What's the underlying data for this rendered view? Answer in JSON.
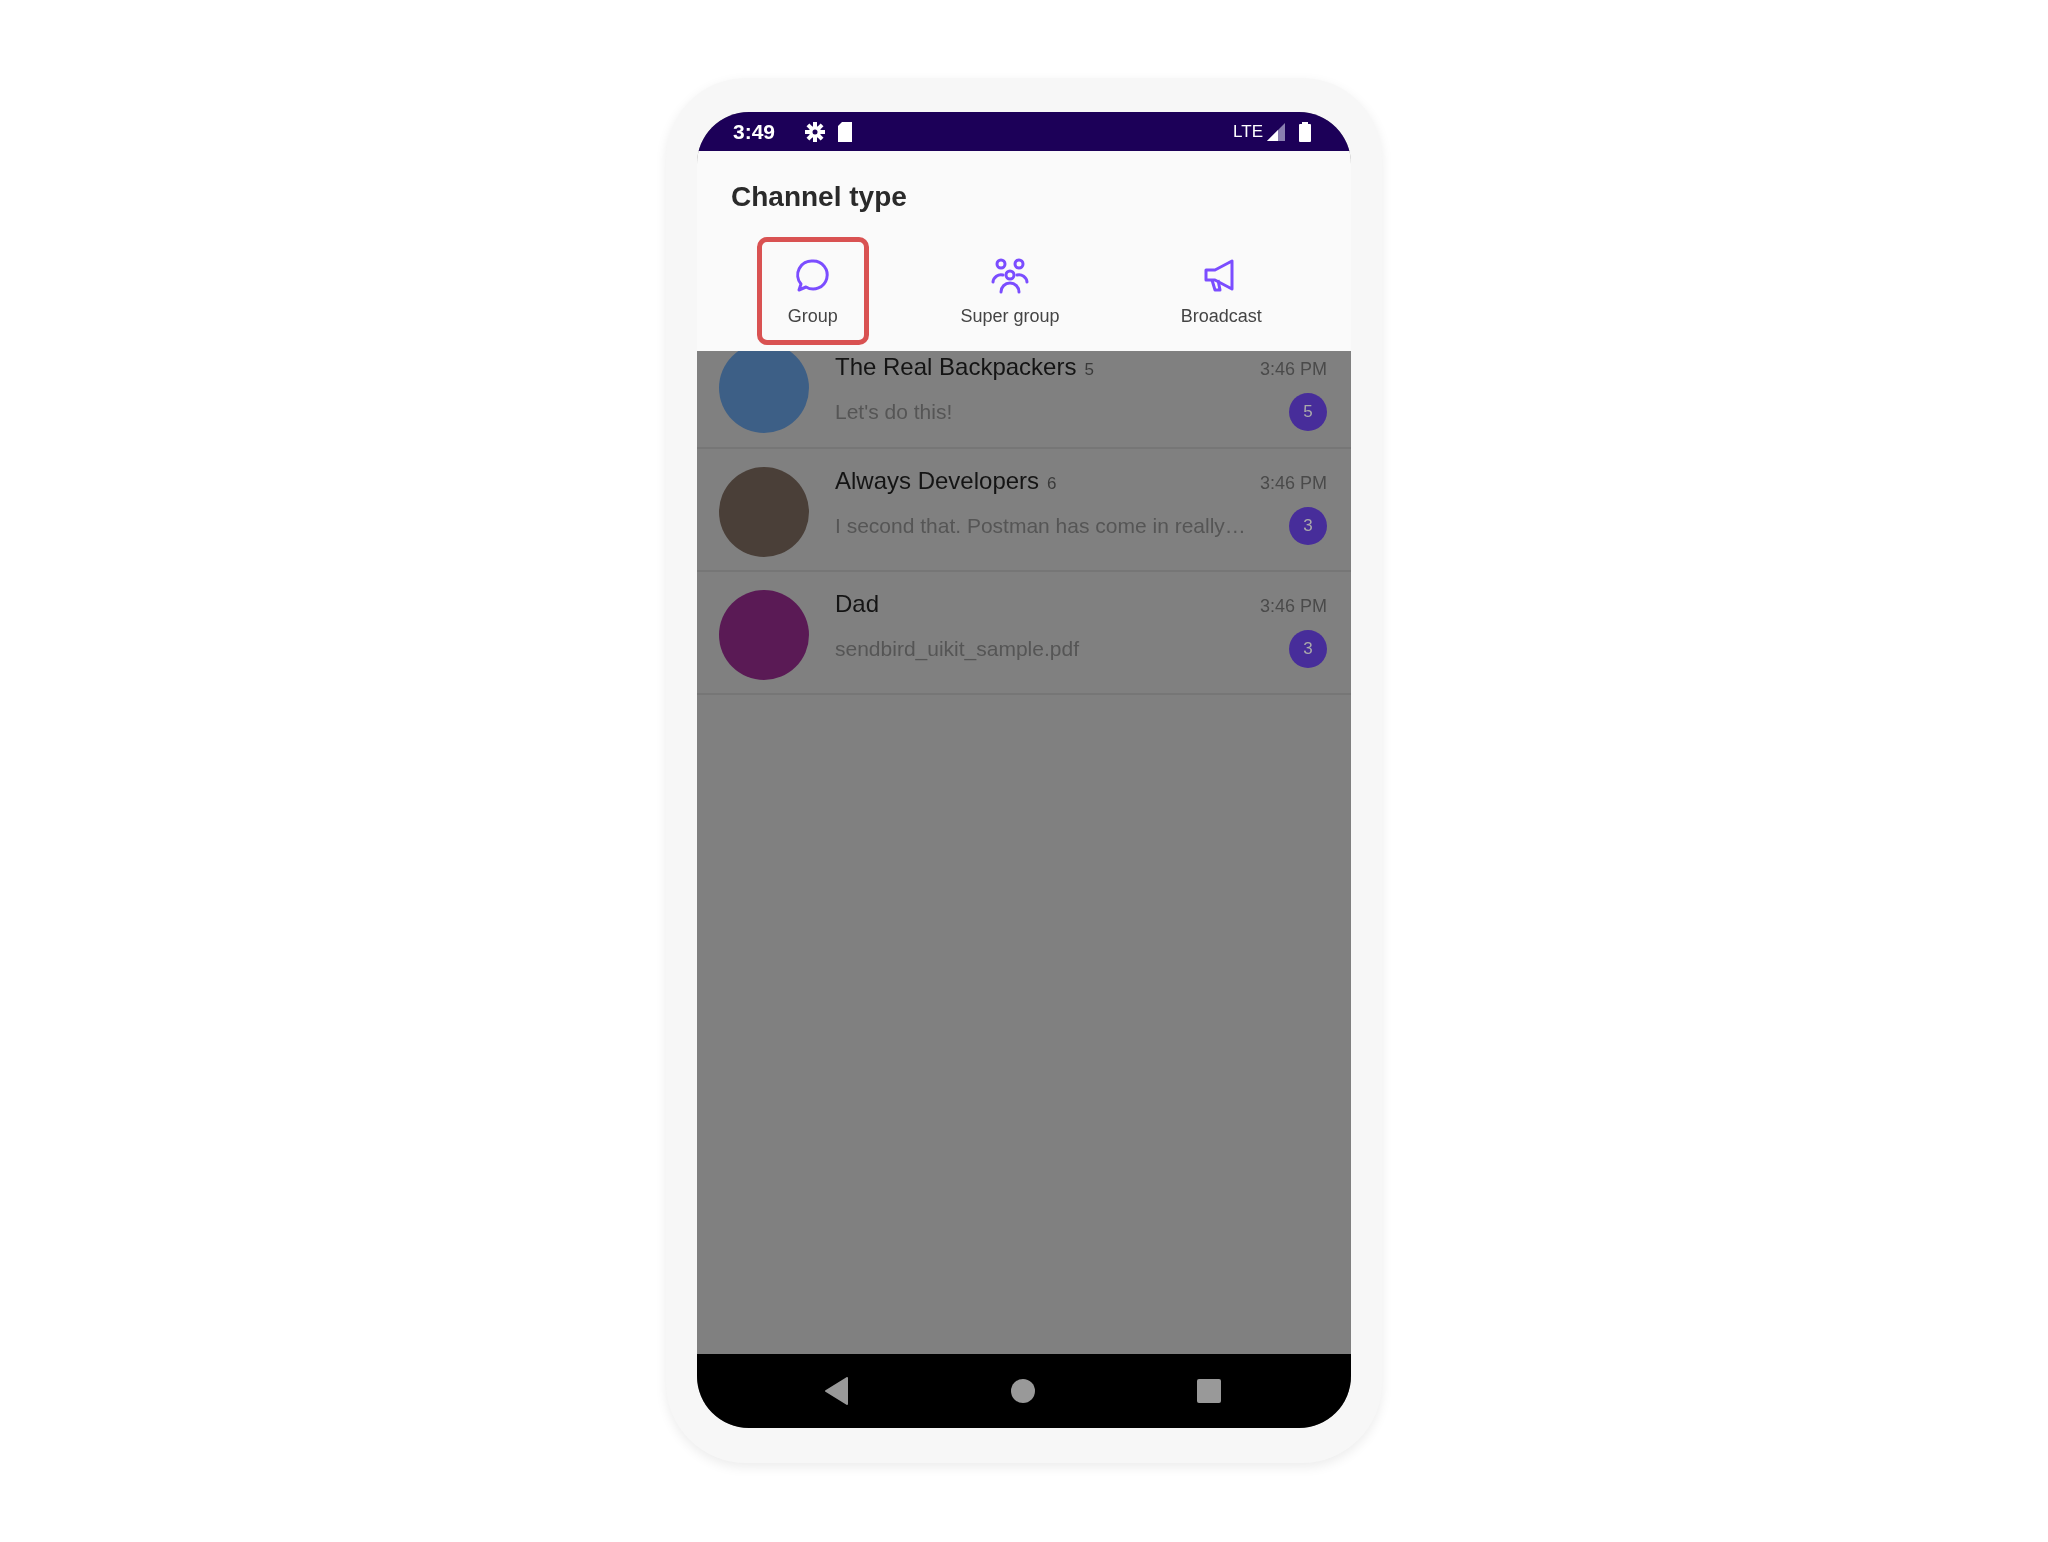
{
  "status_bar": {
    "time": "3:49",
    "network": "LTE"
  },
  "sheet": {
    "title": "Channel type",
    "tabs": [
      {
        "label": "Group",
        "kind": "chat",
        "selected": true
      },
      {
        "label": "Super group",
        "kind": "people",
        "selected": false
      },
      {
        "label": "Broadcast",
        "kind": "megaphone",
        "selected": false
      }
    ]
  },
  "channels": [
    {
      "name": "The Real Backpackers",
      "members": "5",
      "time": "3:46 PM",
      "preview": "Let's do this!",
      "unread": "5",
      "color": "#3d5f86"
    },
    {
      "name": "Always Developers",
      "members": "6",
      "time": "3:46 PM",
      "preview": "I second that. Postman has come in really…",
      "unread": "3",
      "color": "#4a3f38"
    },
    {
      "name": "Dad",
      "time": "3:46 PM",
      "preview": "sendbird_uikit_sample.pdf",
      "unread": "3",
      "color": "#5a1a55"
    }
  ]
}
